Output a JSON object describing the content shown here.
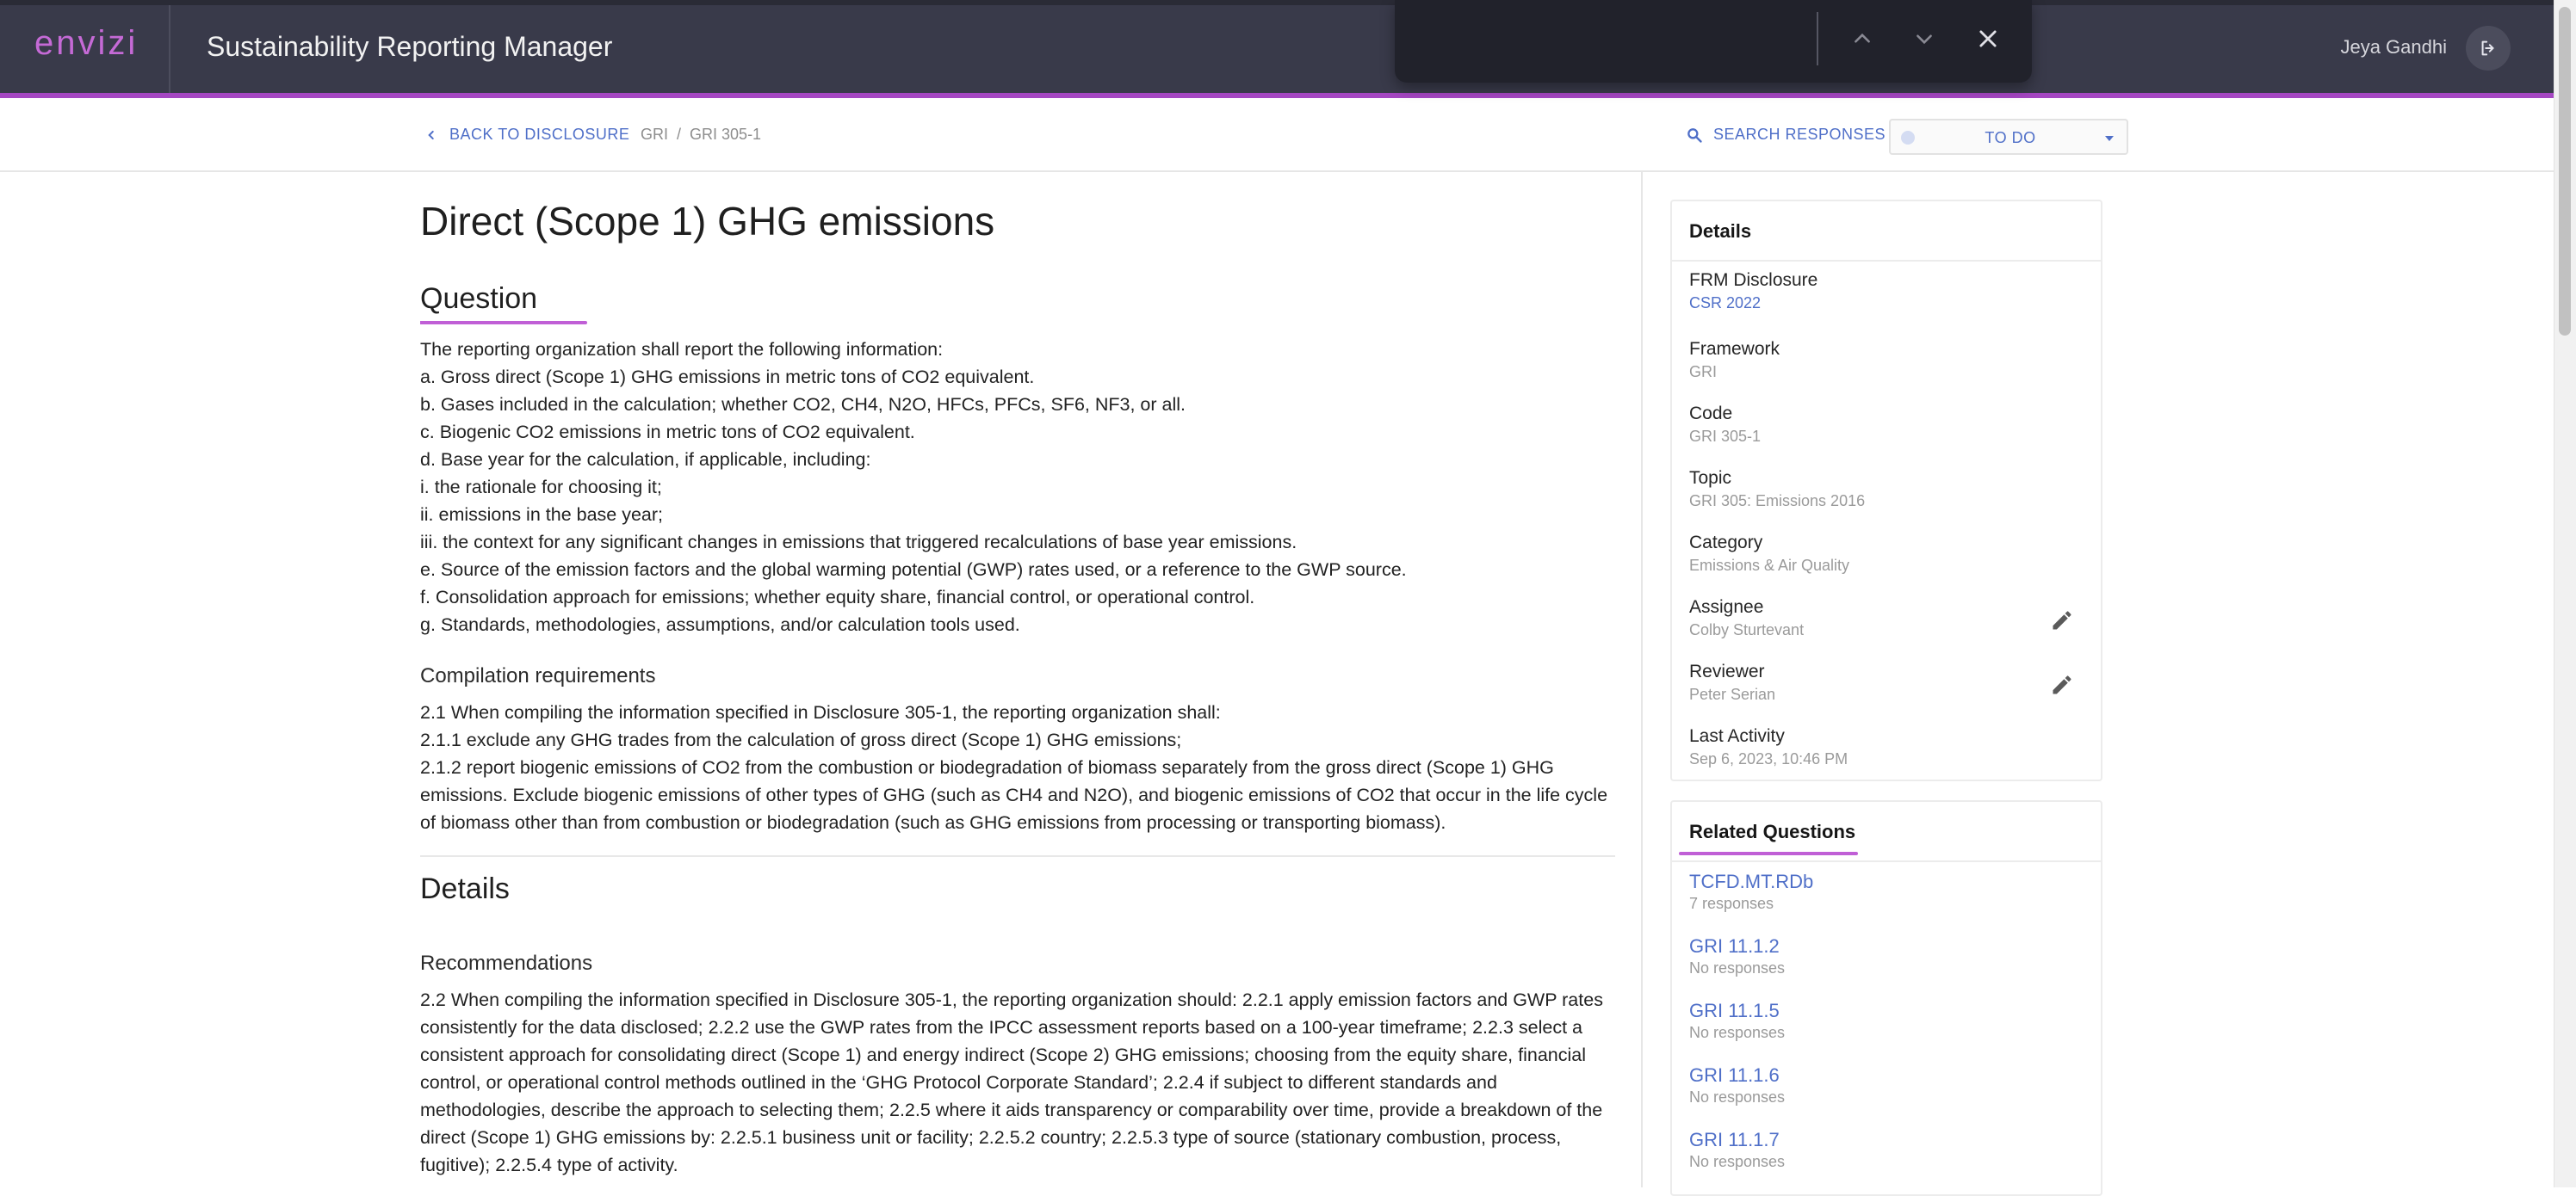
{
  "header": {
    "logo_text": "envizi",
    "app_title": "Sustainability Reporting Manager",
    "user_name": "Jeya Gandhi",
    "accent_color": "#a547c2"
  },
  "find_bar": {
    "query": "",
    "prev_icon": "chevron-up-icon",
    "next_icon": "chevron-down-icon",
    "close_icon": "close-icon"
  },
  "subbar": {
    "back_label": "BACK TO DISCLOSURE",
    "breadcrumb": [
      "GRI",
      "GRI 305-1"
    ],
    "breadcrumb_separator": "/",
    "search_label": "SEARCH RESPONSES",
    "status_value": "TO DO"
  },
  "main": {
    "title": "Direct (Scope 1) GHG emissions",
    "question_heading": "Question",
    "question_lines": [
      "The reporting organization shall report the following information:",
      "a. Gross direct (Scope 1) GHG emissions in metric tons of CO2 equivalent.",
      "b. Gases included in the calculation; whether CO2, CH4, N2O, HFCs, PFCs, SF6, NF3, or all.",
      "c. Biogenic CO2 emissions in metric tons of CO2 equivalent.",
      "d. Base year for the calculation, if applicable, including:",
      "i. the rationale for choosing it;",
      "ii. emissions in the base year;",
      "iii. the context for any significant changes in emissions that triggered recalculations of base year emissions.",
      "e. Source of the emission factors and the global warming potential (GWP) rates used, or a reference to the GWP source.",
      "f. Consolidation approach for emissions; whether equity share, financial control, or operational control.",
      "g. Standards, methodologies, assumptions, and/or calculation tools used."
    ],
    "compilation_heading": "Compilation requirements",
    "compilation_lines": [
      "2.1 When compiling the information specified in Disclosure 305-1, the reporting organization shall:",
      "2.1.1 exclude any GHG trades from the calculation of gross direct (Scope 1) GHG emissions;",
      "2.1.2 report biogenic emissions of CO2 from the combustion or biodegradation of biomass separately from the gross direct (Scope 1) GHG emissions. Exclude biogenic emissions of other types of GHG (such as CH4 and N2O), and biogenic emissions of CO2 that occur in the life cycle of biomass other than from combustion or biodegradation (such as GHG emissions from processing or transporting biomass)."
    ],
    "details_heading": "Details",
    "recommendations_heading": "Recommendations",
    "recommendations_text": "2.2 When compiling the information specified in Disclosure 305-1, the reporting organization should: 2.2.1 apply emission factors and GWP rates consistently for the data disclosed; 2.2.2 use the GWP rates from the IPCC assessment reports based on a 100-year timeframe; 2.2.3 select a consistent approach for consolidating direct (Scope 1) and energy indirect (Scope 2) GHG emissions; choosing from the equity share, financial control, or operational control methods outlined in the ‘GHG Protocol Corporate Standard’; 2.2.4 if subject to different standards and methodologies, describe the approach to selecting them; 2.2.5 where it aids transparency or comparability over time, provide a breakdown of the direct (Scope 1) GHG emissions by: 2.2.5.1 business unit or facility; 2.2.5.2 country; 2.2.5.3 type of source (stationary combustion, process, fugitive); 2.2.5.4 type of activity."
  },
  "details_panel": {
    "heading": "Details",
    "fields": [
      {
        "label": "FRM Disclosure",
        "value": "CSR 2022"
      },
      {
        "label": "Framework",
        "value": "GRI"
      },
      {
        "label": "Code",
        "value": "GRI 305-1"
      },
      {
        "label": "Topic",
        "value": "GRI 305: Emissions 2016"
      },
      {
        "label": "Category",
        "value": "Emissions & Air Quality"
      },
      {
        "label": "Assignee",
        "value": "Colby Sturtevant"
      },
      {
        "label": "Reviewer",
        "value": "Peter Serian"
      },
      {
        "label": "Last Activity",
        "value": "Sep 6, 2023, 10:46 PM"
      }
    ]
  },
  "related_panel": {
    "heading": "Related Questions",
    "items": [
      {
        "code": "TCFD.MT.RDb",
        "responses": "7 responses"
      },
      {
        "code": "GRI 11.1.2",
        "responses": "No responses"
      },
      {
        "code": "GRI 11.1.5",
        "responses": "No responses"
      },
      {
        "code": "GRI 11.1.6",
        "responses": "No responses"
      },
      {
        "code": "GRI 11.1.7",
        "responses": "No responses"
      }
    ]
  }
}
